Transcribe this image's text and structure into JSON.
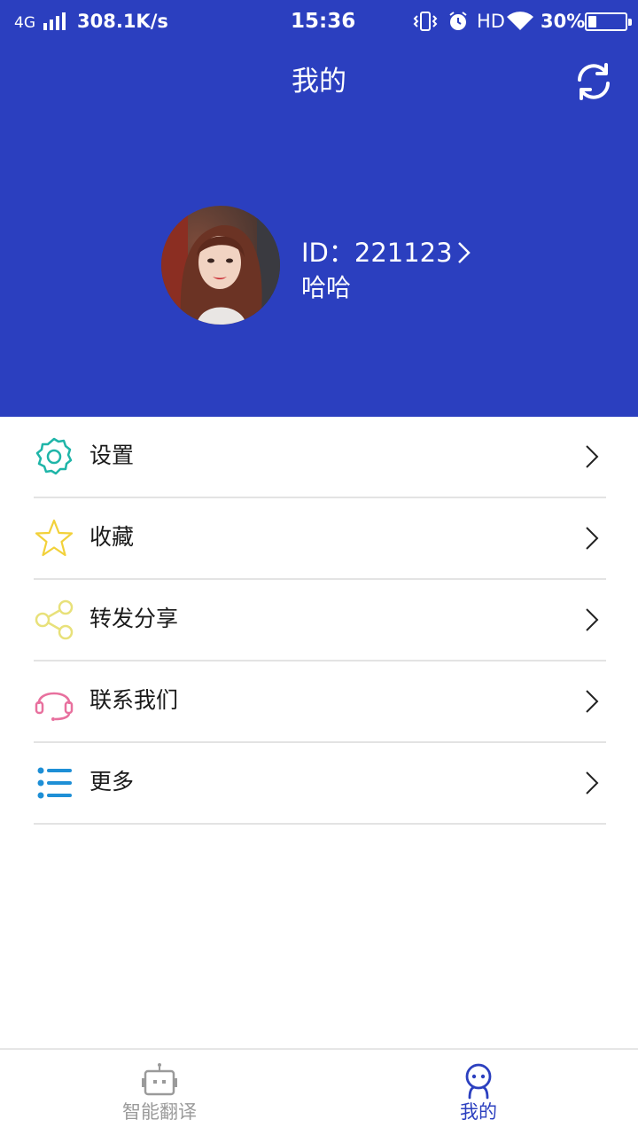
{
  "status_bar": {
    "network": "4G",
    "speed": "308.1K/s",
    "time": "15:36",
    "hd": "HD",
    "battery_percent": "30%",
    "battery_level": 0.3,
    "icons": [
      "signal-icon",
      "vibrate-icon",
      "alarm-icon",
      "wifi-icon",
      "battery-icon"
    ]
  },
  "header": {
    "title": "我的",
    "background_color": "#2b3fbf",
    "refresh_icon": "refresh-icon"
  },
  "profile": {
    "id_text": "ID：221123",
    "name": "哈哈",
    "avatar": "avatar-photo"
  },
  "menu": {
    "items": [
      {
        "label": "设置",
        "icon": "gear-icon",
        "color": "#1fb5a8"
      },
      {
        "label": "收藏",
        "icon": "star-icon",
        "color": "#f2d13a"
      },
      {
        "label": "转发分享",
        "icon": "share-icon",
        "color": "#e8e17a"
      },
      {
        "label": "联系我们",
        "icon": "headset-icon",
        "color": "#e8709e"
      },
      {
        "label": "更多",
        "icon": "list-icon",
        "color": "#1e8fd6"
      }
    ]
  },
  "tabbar": {
    "tabs": [
      {
        "label": "智能翻译",
        "icon": "robot-icon",
        "active": false
      },
      {
        "label": "我的",
        "icon": "user-icon",
        "active": true
      }
    ],
    "active_color": "#2b3fbf",
    "inactive_color": "#9a9a9a"
  }
}
